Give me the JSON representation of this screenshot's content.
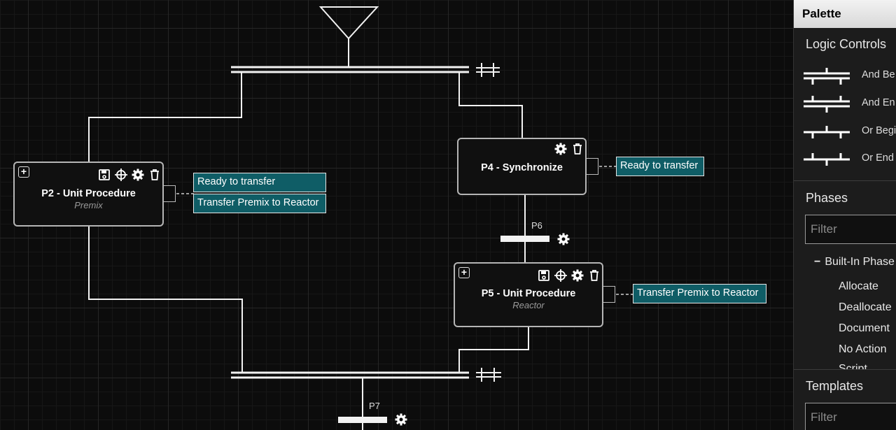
{
  "nodes": {
    "p2": {
      "title": "P2 - Unit Procedure",
      "subtitle": "Premix"
    },
    "p4": {
      "title": "P4 - Synchronize"
    },
    "p5": {
      "title": "P5 - Unit Procedure",
      "subtitle": "Reactor"
    }
  },
  "tags": {
    "p2_ready": "Ready to transfer",
    "p2_transfer": "Transfer Premix to Reactor",
    "p4_ready": "Ready to transfer",
    "p5_transfer": "Transfer Premix to Reactor"
  },
  "steps": {
    "p6": "P6",
    "p7": "P7"
  },
  "palette": {
    "title": "Palette",
    "logic_controls": {
      "title": "Logic Controls",
      "items": [
        "And Be",
        "And En",
        "Or Begi",
        "Or End"
      ]
    },
    "phases": {
      "title": "Phases",
      "filter_placeholder": "Filter",
      "group_toggle": "−",
      "group": "Built-In Phase",
      "items": [
        "Allocate",
        "Deallocate",
        "Document",
        "No Action",
        "Script"
      ]
    },
    "templates": {
      "title": "Templates",
      "filter_placeholder": "Filter"
    }
  },
  "colors": {
    "tag_bg": "#0f5d66",
    "canvas_bg": "#0c0c0c",
    "palette_bg": "#1c1c1c"
  }
}
